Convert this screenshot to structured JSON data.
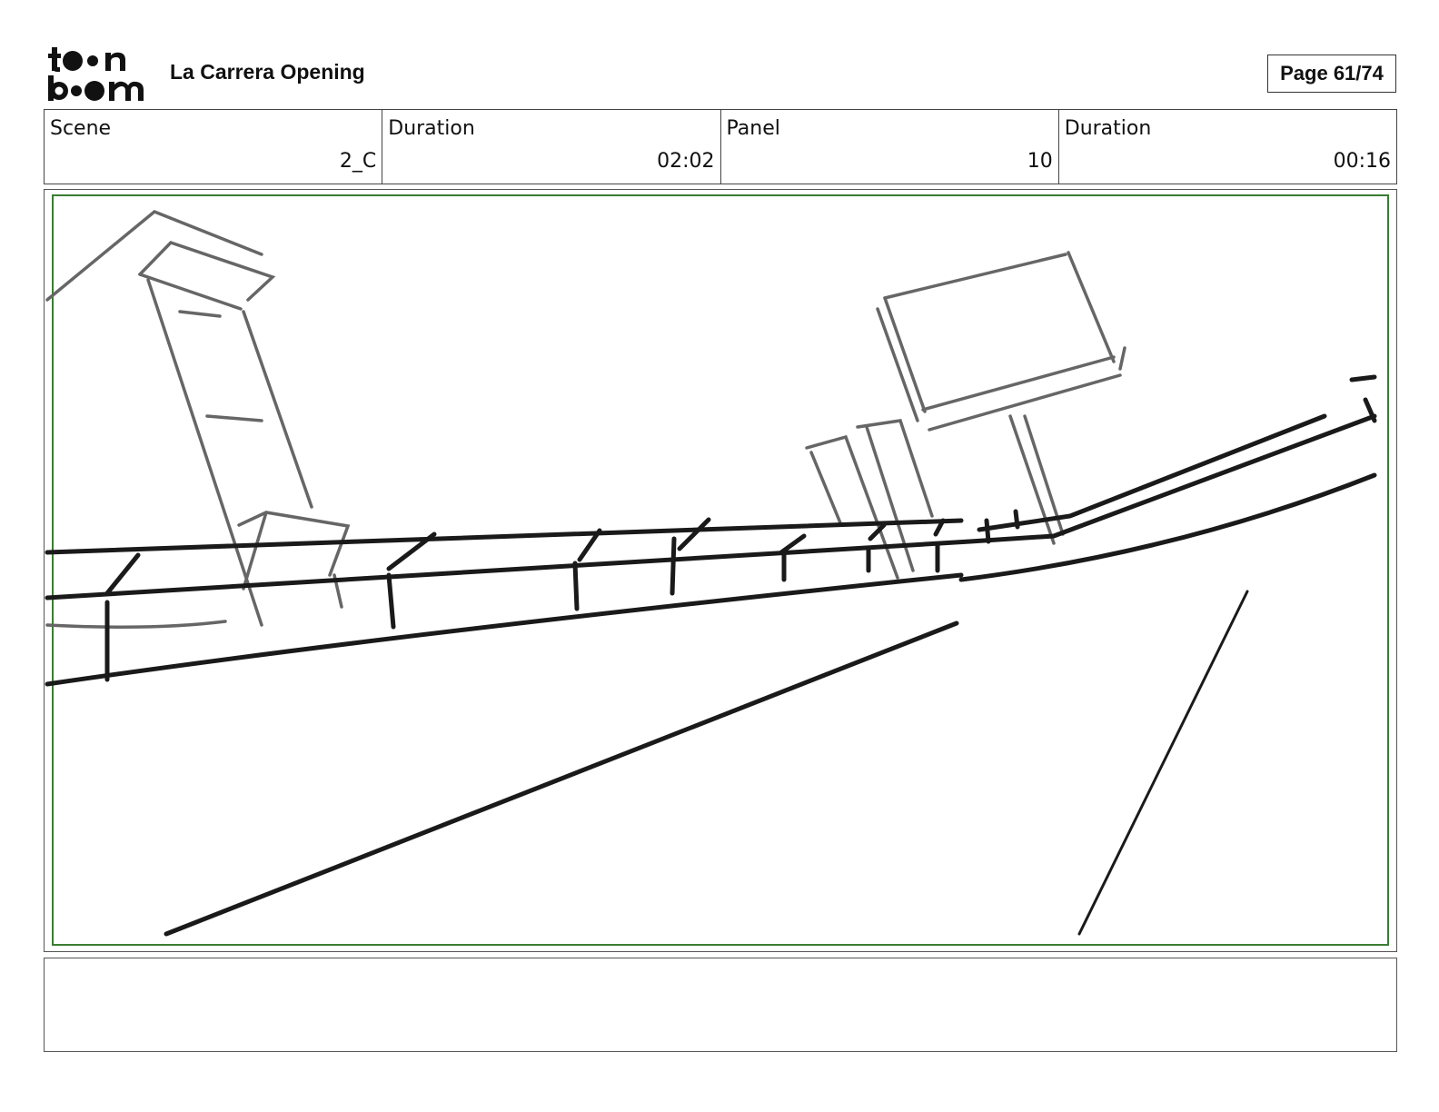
{
  "header": {
    "logo_text": "toon boom",
    "project_title": "La Carrera Opening",
    "page_label": "Page 61/74"
  },
  "info": [
    {
      "label": "Scene",
      "value": "2_C"
    },
    {
      "label": "Duration",
      "value": "02:02"
    },
    {
      "label": "Panel",
      "value": "10"
    },
    {
      "label": "Duration",
      "value": "00:16"
    }
  ],
  "colors": {
    "safe_frame": "#3a7d32",
    "sketch_dark": "#1a1a1a",
    "sketch_grey": "#666666"
  },
  "notes": ""
}
